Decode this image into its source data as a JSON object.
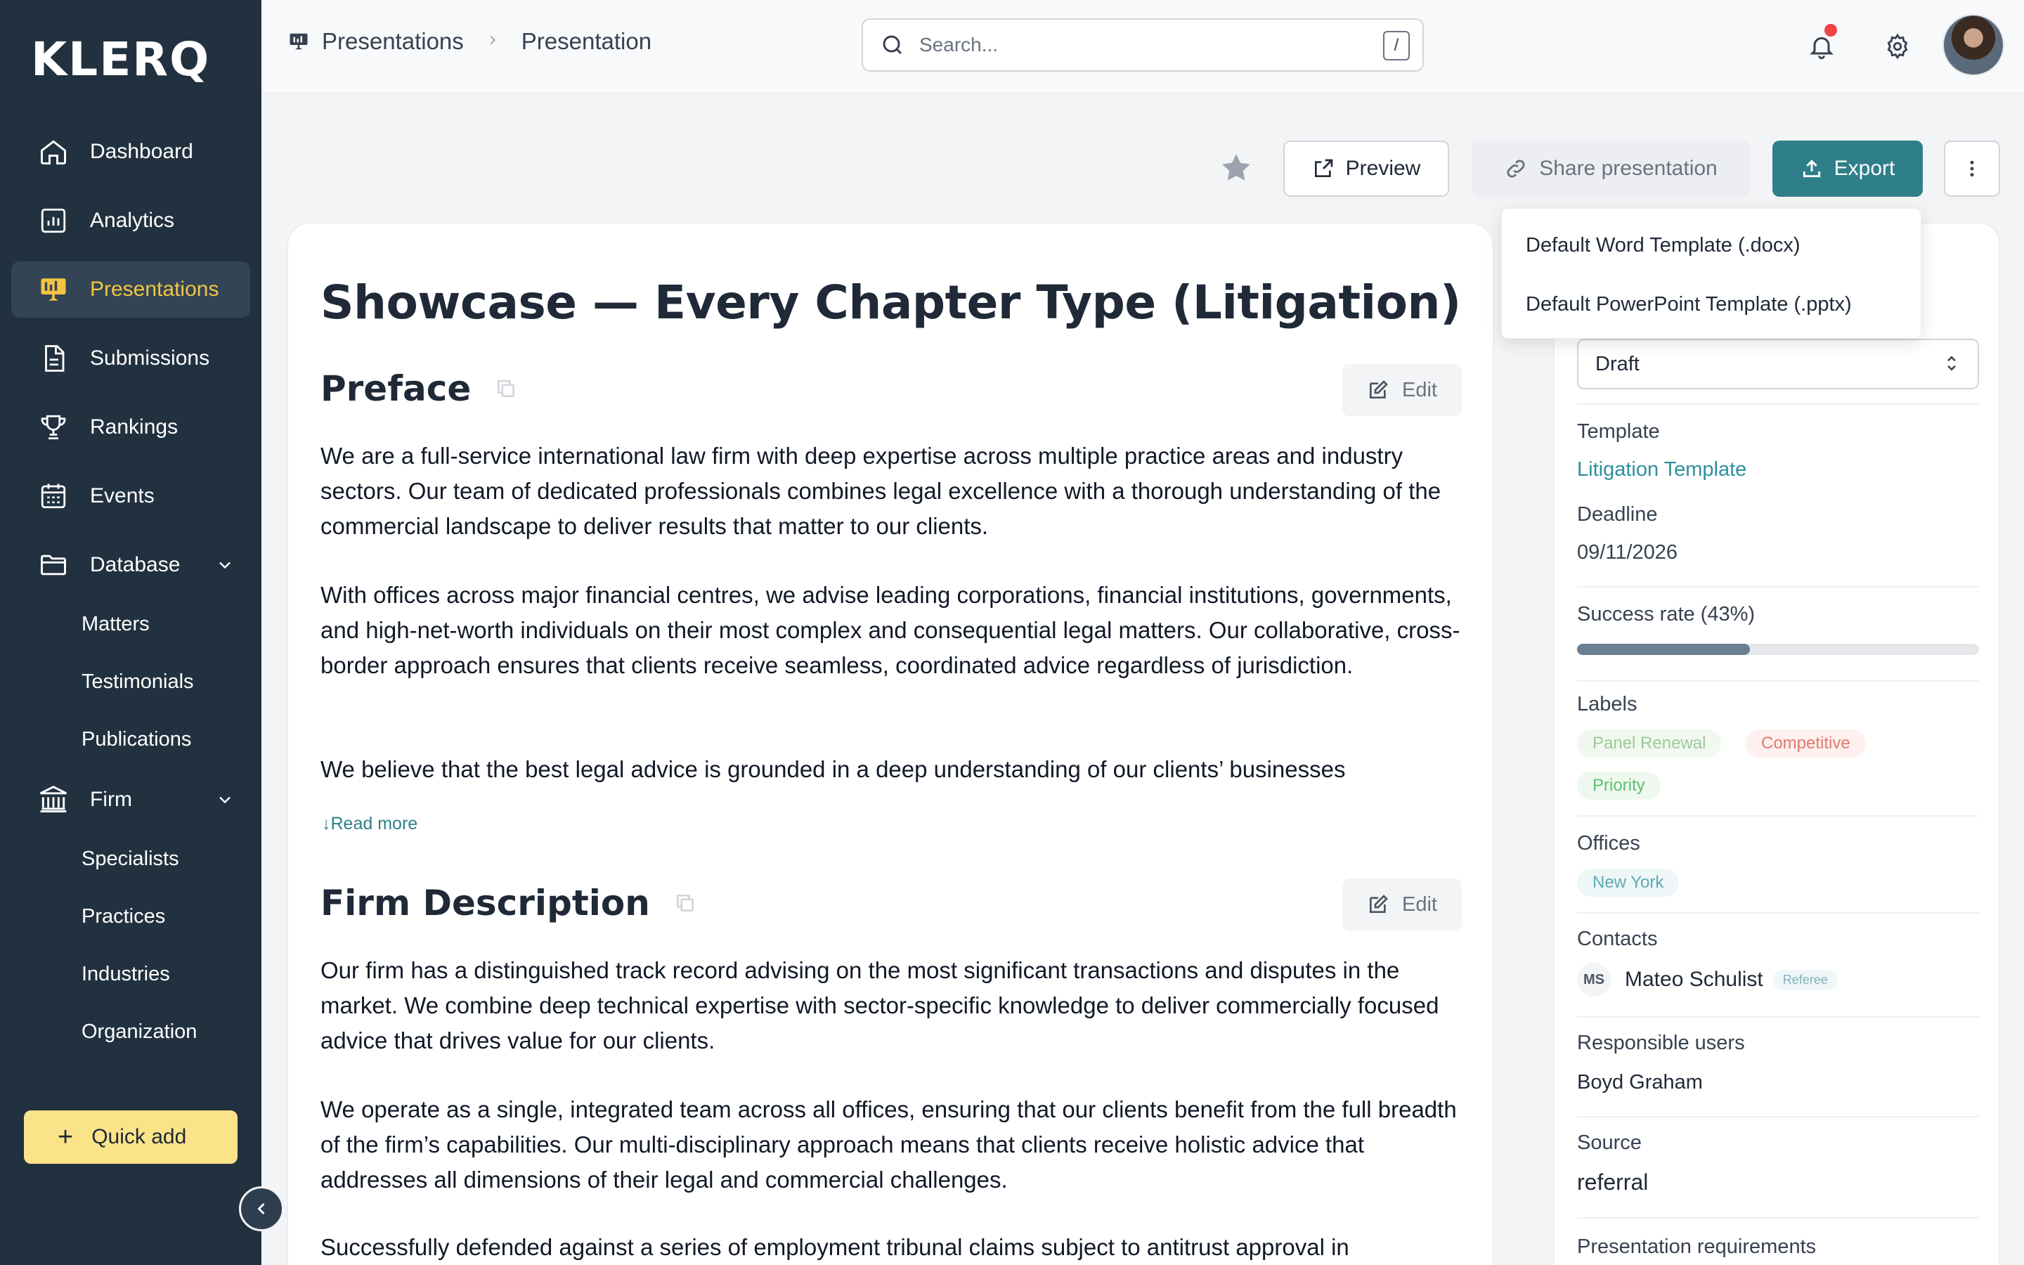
{
  "app": {
    "logo": "KLERQ"
  },
  "sidebar": {
    "items": [
      {
        "label": "Dashboard",
        "icon": "home-icon"
      },
      {
        "label": "Analytics",
        "icon": "chart-icon"
      },
      {
        "label": "Presentations",
        "icon": "presentation-icon",
        "active": true
      },
      {
        "label": "Submissions",
        "icon": "document-icon"
      },
      {
        "label": "Rankings",
        "icon": "trophy-icon"
      },
      {
        "label": "Events",
        "icon": "calendar-icon"
      },
      {
        "label": "Database",
        "icon": "folder-icon",
        "expanded": true
      }
    ],
    "database_sub": [
      "Matters",
      "Testimonials",
      "Publications"
    ],
    "firm": {
      "label": "Firm",
      "icon": "bank-icon"
    },
    "firm_sub": [
      "Specialists",
      "Practices",
      "Industries",
      "Organization"
    ],
    "quick_add": "Quick add"
  },
  "header": {
    "breadcrumb": [
      "Presentations",
      "Presentation"
    ],
    "search_placeholder": "Search...",
    "search_shortcut": "/"
  },
  "actions": {
    "preview": "Preview",
    "share": "Share presentation",
    "export": "Export"
  },
  "export_menu": [
    "Default Word Template (.docx)",
    "Default PowerPoint Template (.pptx)"
  ],
  "document": {
    "title": "Showcase — Every Chapter Type (Litigation)",
    "edit_label": "Edit",
    "read_more": "Read more",
    "sections": [
      {
        "title": "Preface",
        "paragraphs": [
          "We are a full-service international law firm with deep expertise across multiple practice areas and industry sectors. Our team of dedicated professionals combines legal excellence with a thorough understanding of the commercial landscape to deliver results that matter to our clients.",
          "With offices across major financial centres, we advise leading corporations, financial institutions, governments, and high-net-worth individuals on their most complex and consequential legal matters. Our collaborative, cross-border approach ensures that clients receive seamless, coordinated advice regardless of jurisdiction.",
          "We believe that the best legal advice is grounded in a deep understanding of our clients’ businesses"
        ]
      },
      {
        "title": "Firm Description",
        "paragraphs": [
          "Our firm has a distinguished track record advising on the most significant transactions and disputes in the market. We combine deep technical expertise with sector-specific knowledge to deliver commercially focused advice that drives value for our clients.",
          "We operate as a single, integrated team across all offices, ensuring that our clients benefit from the full breadth of the firm’s capabilities. Our multi-disciplinary approach means that clients receive holistic advice that addresses all dimensions of their legal and commercial challenges.",
          "Successfully defended against a series of employment tribunal claims subject to antitrust approval in"
        ]
      }
    ]
  },
  "details": {
    "status": "Draft",
    "template_label": "Template",
    "template_value": "Litigation Template",
    "deadline_label": "Deadline",
    "deadline_value": "09/11/2026",
    "success_label": "Success rate (43%)",
    "success_rate": 0.43,
    "labels_label": "Labels",
    "labels": [
      {
        "text": "Panel Renewal",
        "color": "#9cc99a",
        "bg": "#f1f8ef"
      },
      {
        "text": "Competitive",
        "color": "#e07a6f",
        "bg": "#fdf0ee"
      },
      {
        "text": "Priority",
        "color": "#5fbf6b",
        "bg": "#eef8ef"
      }
    ],
    "offices_label": "Offices",
    "offices": [
      "New York"
    ],
    "contacts_label": "Contacts",
    "contact": {
      "initials": "MS",
      "name": "Mateo Schulist",
      "role": "Referee"
    },
    "responsible_label": "Responsible users",
    "responsible_value": "Boyd Graham",
    "source_label": "Source",
    "source_value": "referral",
    "requirements_label": "Presentation requirements"
  },
  "colors": {
    "accent": "#2f7f8a",
    "sidebar": "#22313f",
    "active_text": "#f4c542",
    "quick_add": "#fbe38a"
  }
}
